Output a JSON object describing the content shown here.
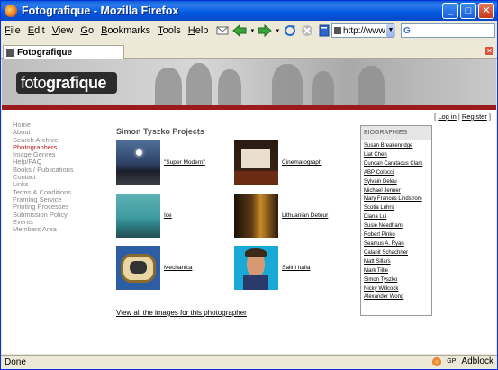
{
  "window": {
    "title": "Fotografique - Mozilla Firefox",
    "buttons": {
      "minimize": "_",
      "maximize": "□",
      "close": "✕"
    }
  },
  "menu": [
    {
      "label": "File",
      "u": "F",
      "rest": "ile"
    },
    {
      "label": "Edit",
      "u": "E",
      "rest": "dit"
    },
    {
      "label": "View",
      "u": "V",
      "rest": "iew"
    },
    {
      "label": "Go",
      "u": "G",
      "rest": "o"
    },
    {
      "label": "Bookmarks",
      "u": "B",
      "rest": "ookmarks"
    },
    {
      "label": "Tools",
      "u": "T",
      "rest": "ools"
    },
    {
      "label": "Help",
      "u": "H",
      "rest": "elp"
    }
  ],
  "toolbar": {
    "address": "http://www",
    "search_icon": "google-g-icon"
  },
  "tab": {
    "label": "Fotografique"
  },
  "site": {
    "logo_light": "foto",
    "logo_bold": "grafique",
    "login_open": "[ ",
    "login": "Log in",
    "separator": " | ",
    "register": "Register",
    "login_close": " ]",
    "nav": [
      "Home",
      "About",
      "Search Archive",
      "Photographers",
      "Image Genres",
      "Help/FAQ",
      "Books / Publications",
      "Contact",
      "Links",
      "Terms & Conditions",
      "Framing Service",
      "Printing Processes",
      "Submission Policy",
      "Events",
      "Members Area"
    ],
    "active_nav": "Photographers",
    "heading": "Simon Tyszko Projects",
    "projects": [
      {
        "label": "\"Super Modern\""
      },
      {
        "label": "Cinematograph"
      },
      {
        "label": "Ice"
      },
      {
        "label": "Lithuanian Detour"
      },
      {
        "label": "Mechanica"
      },
      {
        "label": "Salini Italia"
      }
    ],
    "view_all": "View all the images for this photographer",
    "bio_heading": "BIOGRAPHIES",
    "biographies": [
      "Susan Breakenridge",
      "Liat Chen",
      "Duncan Caratacus Clark",
      "ABP Colocci",
      "Sylvain Deleu",
      "Michael Jenner",
      "Mary Frances Lindstrom",
      "Scotia Luhrs",
      "Diana Lui",
      "Susie Needham",
      "Robert Pinko",
      "Seamus A. Ryan",
      "Calanit Schachner",
      "Matt Sillars",
      "Mark Tillie",
      "Simon Tyszko",
      "Nicky Willcock",
      "Alexander Wong"
    ]
  },
  "status": {
    "text": "Done",
    "gp": "GP",
    "adblock": "Adblock"
  },
  "colors": {
    "accent_red": "#9b1b1b",
    "active_nav": "#b41a1a",
    "titlebar": "#0058e0"
  }
}
